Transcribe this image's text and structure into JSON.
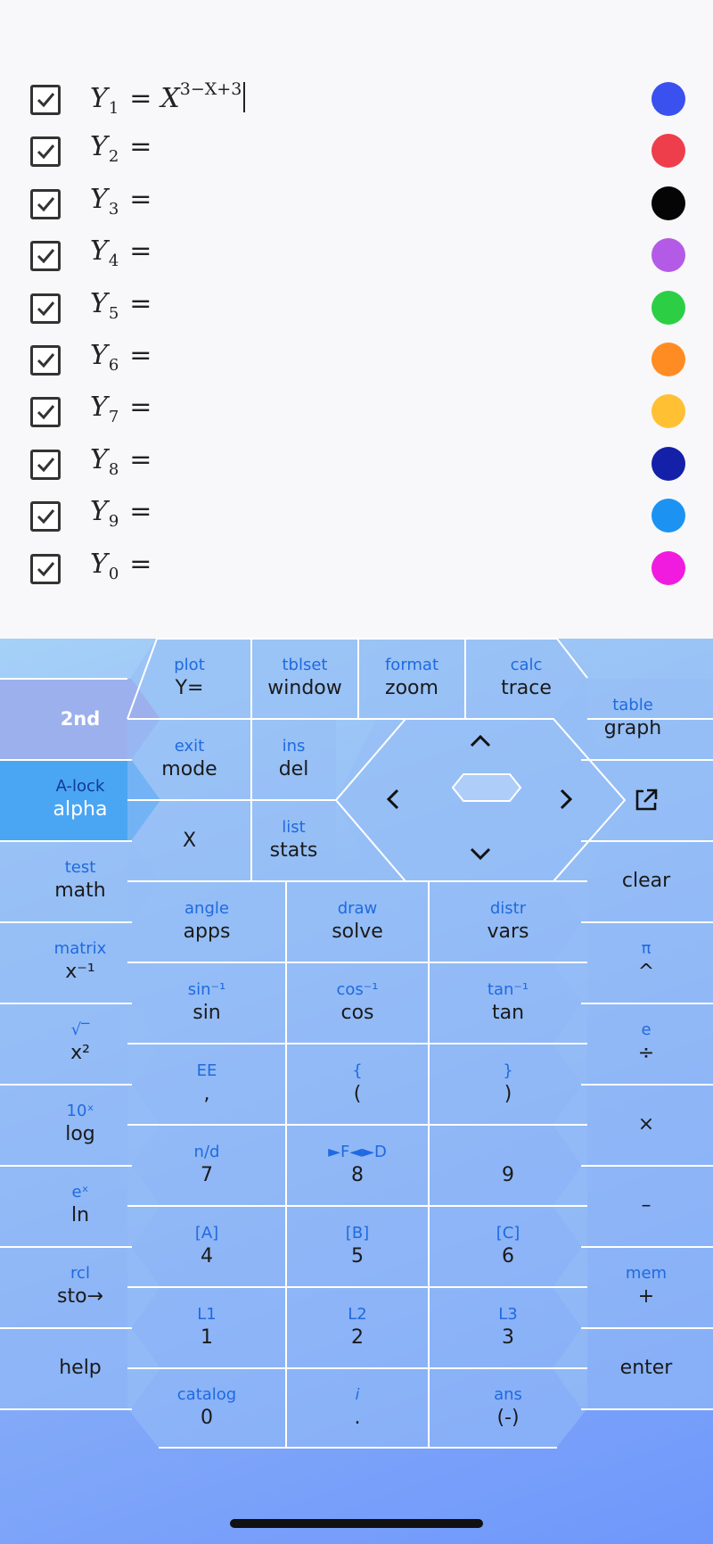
{
  "equations": [
    {
      "name": "Y",
      "sub": "1",
      "expr_var": "X",
      "expr_exp": "3−X+3",
      "color": "#3a50ef",
      "checked": true
    },
    {
      "name": "Y",
      "sub": "2",
      "expr_var": "",
      "expr_exp": "",
      "color": "#ee3e4b",
      "checked": true
    },
    {
      "name": "Y",
      "sub": "3",
      "expr_var": "",
      "expr_exp": "",
      "color": "#050505",
      "checked": true
    },
    {
      "name": "Y",
      "sub": "4",
      "expr_var": "",
      "expr_exp": "",
      "color": "#b35be6",
      "checked": true
    },
    {
      "name": "Y",
      "sub": "5",
      "expr_var": "",
      "expr_exp": "",
      "color": "#2ccf44",
      "checked": true
    },
    {
      "name": "Y",
      "sub": "6",
      "expr_var": "",
      "expr_exp": "",
      "color": "#ff8c22",
      "checked": true
    },
    {
      "name": "Y",
      "sub": "7",
      "expr_var": "",
      "expr_exp": "",
      "color": "#ffc034",
      "checked": true
    },
    {
      "name": "Y",
      "sub": "8",
      "expr_var": "",
      "expr_exp": "",
      "color": "#1420a8",
      "checked": true
    },
    {
      "name": "Y",
      "sub": "9",
      "expr_var": "",
      "expr_exp": "",
      "color": "#1c93f2",
      "checked": true
    },
    {
      "name": "Y",
      "sub": "0",
      "expr_var": "",
      "expr_exp": "",
      "color": "#f11be0",
      "checked": true
    }
  ],
  "equals_sign": "=",
  "keys": {
    "y_eq": {
      "sec": "plot",
      "pri": "Y="
    },
    "window": {
      "sec": "tblset",
      "pri": "window"
    },
    "zoom": {
      "sec": "format",
      "pri": "zoom"
    },
    "trace": {
      "sec": "calc",
      "pri": "trace"
    },
    "second": {
      "sec": "",
      "pri": "2nd"
    },
    "graph": {
      "sec": "table",
      "pri": "graph"
    },
    "mode": {
      "sec": "exit",
      "pri": "mode"
    },
    "del": {
      "sec": "ins",
      "pri": "del"
    },
    "alpha": {
      "sec": "A-lock",
      "pri": "alpha"
    },
    "share": {
      "sec": "",
      "pri": ""
    },
    "x": {
      "sec": "",
      "pri": "X"
    },
    "stats": {
      "sec": "list",
      "pri": "stats"
    },
    "math": {
      "sec": "test",
      "pri": "math"
    },
    "clear": {
      "sec": "",
      "pri": "clear"
    },
    "apps": {
      "sec": "angle",
      "pri": "apps"
    },
    "solve": {
      "sec": "draw",
      "pri": "solve"
    },
    "vars": {
      "sec": "distr",
      "pri": "vars"
    },
    "inverse": {
      "sec": "matrix",
      "pri": "x⁻¹"
    },
    "sin": {
      "sec": "sin⁻¹",
      "pri": "sin"
    },
    "cos": {
      "sec": "cos⁻¹",
      "pri": "cos"
    },
    "tan": {
      "sec": "tan⁻¹",
      "pri": "tan"
    },
    "power": {
      "sec": "π",
      "pri": "^"
    },
    "square": {
      "sec": "√‾",
      "pri": "x²"
    },
    "comma": {
      "sec": "EE",
      "pri": ","
    },
    "lparen": {
      "sec": "{",
      "pri": "("
    },
    "rparen": {
      "sec": "}",
      "pri": ")"
    },
    "divide": {
      "sec": "e",
      "pri": "÷"
    },
    "log": {
      "sec": "10ˣ",
      "pri": "log"
    },
    "seven": {
      "sec": "n/d",
      "pri": "7"
    },
    "eight": {
      "sec": "►F◄►D",
      "pri": "8"
    },
    "nine": {
      "sec": "",
      "pri": "9"
    },
    "times": {
      "sec": "",
      "pri": "×"
    },
    "ln": {
      "sec": "eˣ",
      "pri": "ln"
    },
    "four": {
      "sec": "[A]",
      "pri": "4"
    },
    "five": {
      "sec": "[B]",
      "pri": "5"
    },
    "six": {
      "sec": "[C]",
      "pri": "6"
    },
    "minus": {
      "sec": "",
      "pri": "–"
    },
    "sto": {
      "sec": "rcl",
      "pri": "sto→"
    },
    "one": {
      "sec": "L1",
      "pri": "1"
    },
    "two": {
      "sec": "L2",
      "pri": "2"
    },
    "three": {
      "sec": "L3",
      "pri": "3"
    },
    "plus": {
      "sec": "mem",
      "pri": "+"
    },
    "help": {
      "sec": "",
      "pri": "help"
    },
    "enter": {
      "sec": "",
      "pri": "enter"
    },
    "zero": {
      "sec": "catalog",
      "pri": "0"
    },
    "decimal": {
      "sec": "𝑖",
      "pri": "."
    },
    "negative": {
      "sec": "ans",
      "pri": "(-)"
    }
  },
  "dpad": {
    "up": "⌃",
    "down": "⌄",
    "left": "‹",
    "right": "›"
  }
}
